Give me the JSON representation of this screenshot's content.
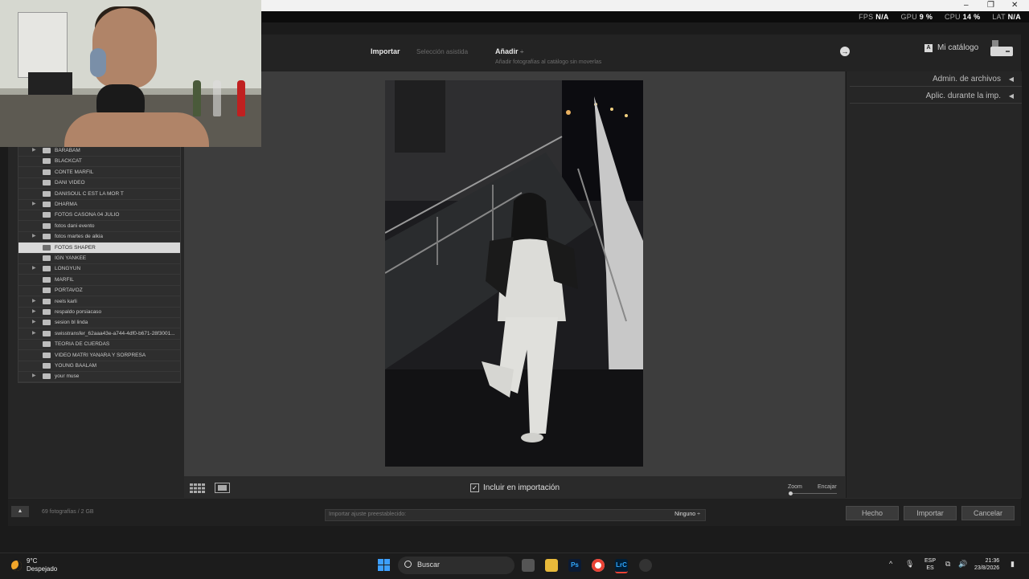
{
  "window_controls": {
    "minimize": "–",
    "maximize": "❐",
    "close": "✕"
  },
  "perf_overlay": {
    "fps_label": "FPS",
    "fps_value": "N/A",
    "gpu_label": "GPU",
    "gpu_value": "9 %",
    "cpu_label": "CPU",
    "cpu_value": "14 %",
    "lat_label": "LAT",
    "lat_value": "N/A"
  },
  "modes": {
    "importar": "Importar",
    "seleccion": "Selección asistida",
    "anadir": "Añadir",
    "anadir_arrow": "÷",
    "anadir_sub": "Añadir fotografías al catálogo sin moverlas"
  },
  "catalog": {
    "badge": "A",
    "label": "Mi catálogo"
  },
  "arrow_icon": "→",
  "folders": [
    {
      "label": "BARABAM",
      "expand": true,
      "selected": false
    },
    {
      "label": "BLACKCAT",
      "expand": false,
      "selected": false
    },
    {
      "label": "CONTE MARFIL",
      "expand": false,
      "selected": false
    },
    {
      "label": "DANI VIDEO",
      "expand": false,
      "selected": false
    },
    {
      "label": "DANISOUL C EST LA MOR T",
      "expand": false,
      "selected": false
    },
    {
      "label": "DHARMA",
      "expand": true,
      "selected": false
    },
    {
      "label": "FOTOS CASONA 04 JULIO",
      "expand": false,
      "selected": false
    },
    {
      "label": "fotos dani evento",
      "expand": false,
      "selected": false
    },
    {
      "label": "fotos martes de alkia",
      "expand": true,
      "selected": false
    },
    {
      "label": "FOTOS SHAPER",
      "expand": false,
      "selected": true
    },
    {
      "label": "IGN YANKEE",
      "expand": false,
      "selected": false
    },
    {
      "label": "LONGYUN",
      "expand": true,
      "selected": false
    },
    {
      "label": "MARFIL",
      "expand": false,
      "selected": false
    },
    {
      "label": "PORTAVOZ",
      "expand": false,
      "selected": false
    },
    {
      "label": "reels karli",
      "expand": true,
      "selected": false
    },
    {
      "label": "respaldo porsiacaso",
      "expand": true,
      "selected": false
    },
    {
      "label": "sesion bl linda",
      "expand": true,
      "selected": false
    },
    {
      "label": "swisstransfer_62aaa43e-a744-4df0-b671-28f3001...",
      "expand": true,
      "selected": false
    },
    {
      "label": "TEORIA DE CUERDAS",
      "expand": false,
      "selected": false
    },
    {
      "label": "VIDEO MATRI YANARA Y SORPRESA",
      "expand": false,
      "selected": false
    },
    {
      "label": "YOUNG BAALAM",
      "expand": false,
      "selected": false
    },
    {
      "label": "your muse",
      "expand": true,
      "selected": false
    }
  ],
  "right_panel": {
    "admin": "Admin. de archivos",
    "aplic": "Aplic. durante la imp.",
    "collapse_glyph": "◀"
  },
  "toolbar": {
    "include_check": "✓",
    "include_label": "Incluir en importación",
    "zoom": "Zoom",
    "fit": "Encajar"
  },
  "bottom": {
    "collapse": "▲",
    "count": "69 fotografías / 2 GB",
    "preset_label": "Importar ajuste preestablecido:",
    "preset_value": "Ninguno ÷",
    "btn_done": "Hecho",
    "btn_import": "Importar",
    "btn_cancel": "Cancelar"
  },
  "taskbar": {
    "temp": "9°C",
    "weather": "Despejado",
    "search": "Buscar",
    "ps": "Ps",
    "lrc": "LrC",
    "lang1": "ESP",
    "lang2": "ES",
    "time": "21:36",
    "date": "23/8/2026",
    "tray_up": "^",
    "tray_mic": "🎙",
    "tray_net": "⧉",
    "tray_vol": "🔊",
    "tray_bat": "▮"
  },
  "colors": {
    "accent": "#3d9fff",
    "selected_row": "#d9d9d9",
    "panel": "#262626",
    "center": "#3d3d3d"
  }
}
